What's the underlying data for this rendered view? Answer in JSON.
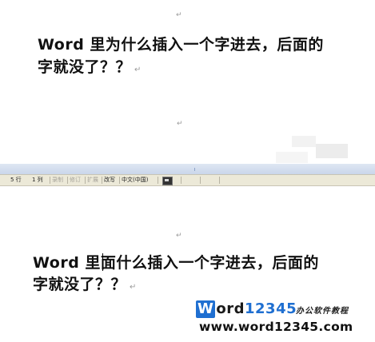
{
  "doc_top": {
    "line1": "Word 里为什么插入一个字进去，后面的",
    "line2": "字就没了？？",
    "para_mark": "↵"
  },
  "statusbar": {
    "line": "5 行",
    "col": "1 列",
    "rec": "录制",
    "trk": "修订",
    "ext": "扩展",
    "ovr": "改写",
    "lang": "中文(中国)"
  },
  "doc_bottom": {
    "line1_a": "Word 里面",
    "line1_b": "什么插入一个字进去，后面的",
    "line2": "字就没了？？",
    "para_mark": "↵"
  },
  "watermark": {
    "brand_w": "W",
    "brand_ord": "ord",
    "brand_digits": "12345",
    "tagline": "办公软件教程",
    "url": "www.word12345.com"
  }
}
